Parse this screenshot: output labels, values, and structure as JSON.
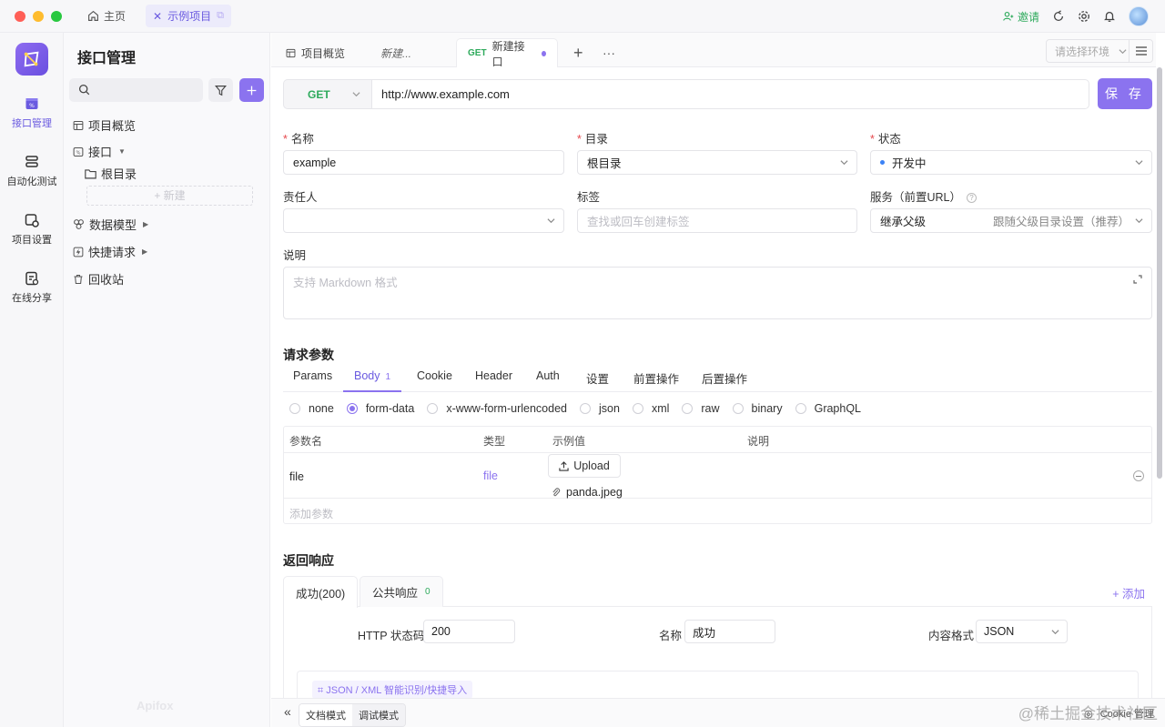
{
  "titlebar": {
    "home_label": "主页",
    "project_tab": "示例项目",
    "invite_label": "邀请",
    "traffic_colors": [
      "#ff5f57",
      "#febc2e",
      "#28c840"
    ]
  },
  "rail": {
    "items": [
      {
        "label": "接口管理",
        "icon": "api-icon"
      },
      {
        "label": "自动化测试",
        "icon": "test-icon"
      },
      {
        "label": "项目设置",
        "icon": "settings-icon"
      },
      {
        "label": "在线分享",
        "icon": "share-icon"
      }
    ]
  },
  "tree": {
    "title": "接口管理",
    "new_label": "+ 新建",
    "items": [
      {
        "label": "项目概览"
      },
      {
        "label": "接口"
      },
      {
        "label": "根目录"
      },
      {
        "label": "数据模型"
      },
      {
        "label": "快捷请求"
      },
      {
        "label": "回收站"
      }
    ],
    "brand": "Apifox"
  },
  "tabs": {
    "overview": "项目概览",
    "new_draft": "新建...",
    "active_method": "GET",
    "active_label": "新建接口",
    "env_placeholder": "请选择环境"
  },
  "request": {
    "method": "GET",
    "url": "http://www.example.com",
    "save_label": "保 存"
  },
  "form": {
    "name_label": "名称",
    "name_value": "example",
    "dir_label": "目录",
    "dir_value": "根目录",
    "status_label": "状态",
    "status_value": "开发中",
    "owner_label": "责任人",
    "tag_label": "标签",
    "tag_placeholder": "查找或回车创建标签",
    "service_label": "服务（前置URL）",
    "service_value": "继承父级",
    "service_hint": "跟随父级目录设置（推荐）",
    "desc_label": "说明",
    "desc_placeholder": "支持 Markdown 格式"
  },
  "params": {
    "title": "请求参数",
    "tabs": [
      "Params",
      "Body",
      "Cookie",
      "Header",
      "Auth",
      "设置",
      "前置操作",
      "后置操作"
    ],
    "body_badge": "1",
    "body_types": [
      "none",
      "form-data",
      "x-www-form-urlencoded",
      "json",
      "xml",
      "raw",
      "binary",
      "GraphQL"
    ],
    "columns": [
      "参数名",
      "类型",
      "示例值",
      "说明"
    ],
    "rows": [
      {
        "name": "file",
        "type": "file",
        "upload_label": "Upload",
        "file_name": "panda.jpeg"
      }
    ],
    "add_placeholder": "添加参数"
  },
  "response": {
    "title": "返回响应",
    "tabs": [
      {
        "label": "成功(200)"
      },
      {
        "label": "公共响应",
        "badge": "0"
      }
    ],
    "add_label": "+ 添加",
    "code_label": "HTTP 状态码",
    "code_value": "200",
    "name_label": "名称",
    "name_value": "成功",
    "format_label": "内容格式",
    "format_value": "JSON",
    "import_label": "JSON / XML 智能识别/快捷导入"
  },
  "footer": {
    "doc_mode": "文档模式",
    "debug_mode": "调试模式",
    "cookie_label": "Cookie 管理",
    "watermark": "@稀土掘金技术社区"
  },
  "colors": {
    "accent": "#8b73ef",
    "get_green": "#2eaa5c",
    "required_red": "#e5484d"
  }
}
